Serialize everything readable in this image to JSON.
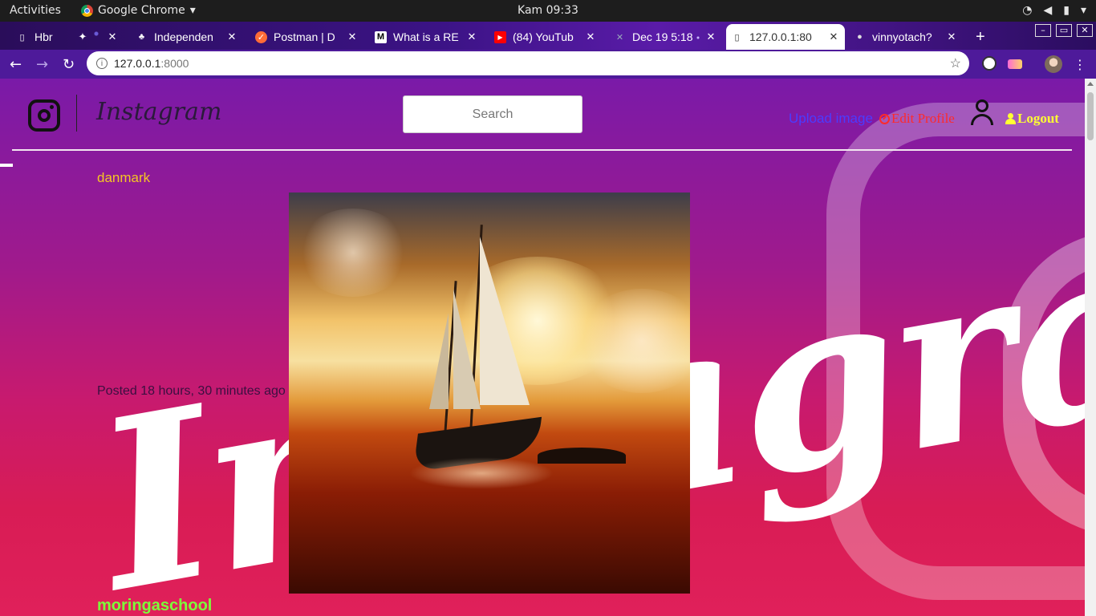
{
  "system_bar": {
    "activities": "Activities",
    "app_name": "Google Chrome",
    "clock": "Kam 09:33"
  },
  "browser": {
    "tabs": [
      {
        "label": "Hbr",
        "favicon": "doc-icon"
      },
      {
        "label": "Independen",
        "favicon": "tree-icon"
      },
      {
        "label": "Postman | D",
        "favicon": "postman-icon"
      },
      {
        "label": "What is a RE",
        "favicon": "medium-icon"
      },
      {
        "label": "(84) YouTub",
        "favicon": "youtube-icon"
      },
      {
        "label": "Dec 19 5:18",
        "favicon": "cross-icon"
      },
      {
        "label": "127.0.0.1:80",
        "favicon": "doc-icon",
        "active": true
      },
      {
        "label": "vinnyotach?",
        "favicon": "github-icon"
      }
    ],
    "url_host": "127.0.0.1",
    "url_port": ":8000"
  },
  "site": {
    "brand": "Instagram",
    "search_placeholder": "Search",
    "nav": {
      "upload": "Upload image",
      "edit_profile": "Edit Profile",
      "logout": "Logout"
    },
    "background_wordmark": "Instagram"
  },
  "posts": [
    {
      "username": "danmark",
      "time": "Posted 18 hours, 30 minutes ago",
      "image_alt": "sailing ship at sunset"
    },
    {
      "username": "moringaschool"
    }
  ],
  "colors": {
    "username_primary": "#f5c623",
    "username_secondary": "#7cff3a",
    "upload_link": "#4b3cff",
    "edit_profile": "#ff2a2a",
    "logout": "#ffff33"
  }
}
